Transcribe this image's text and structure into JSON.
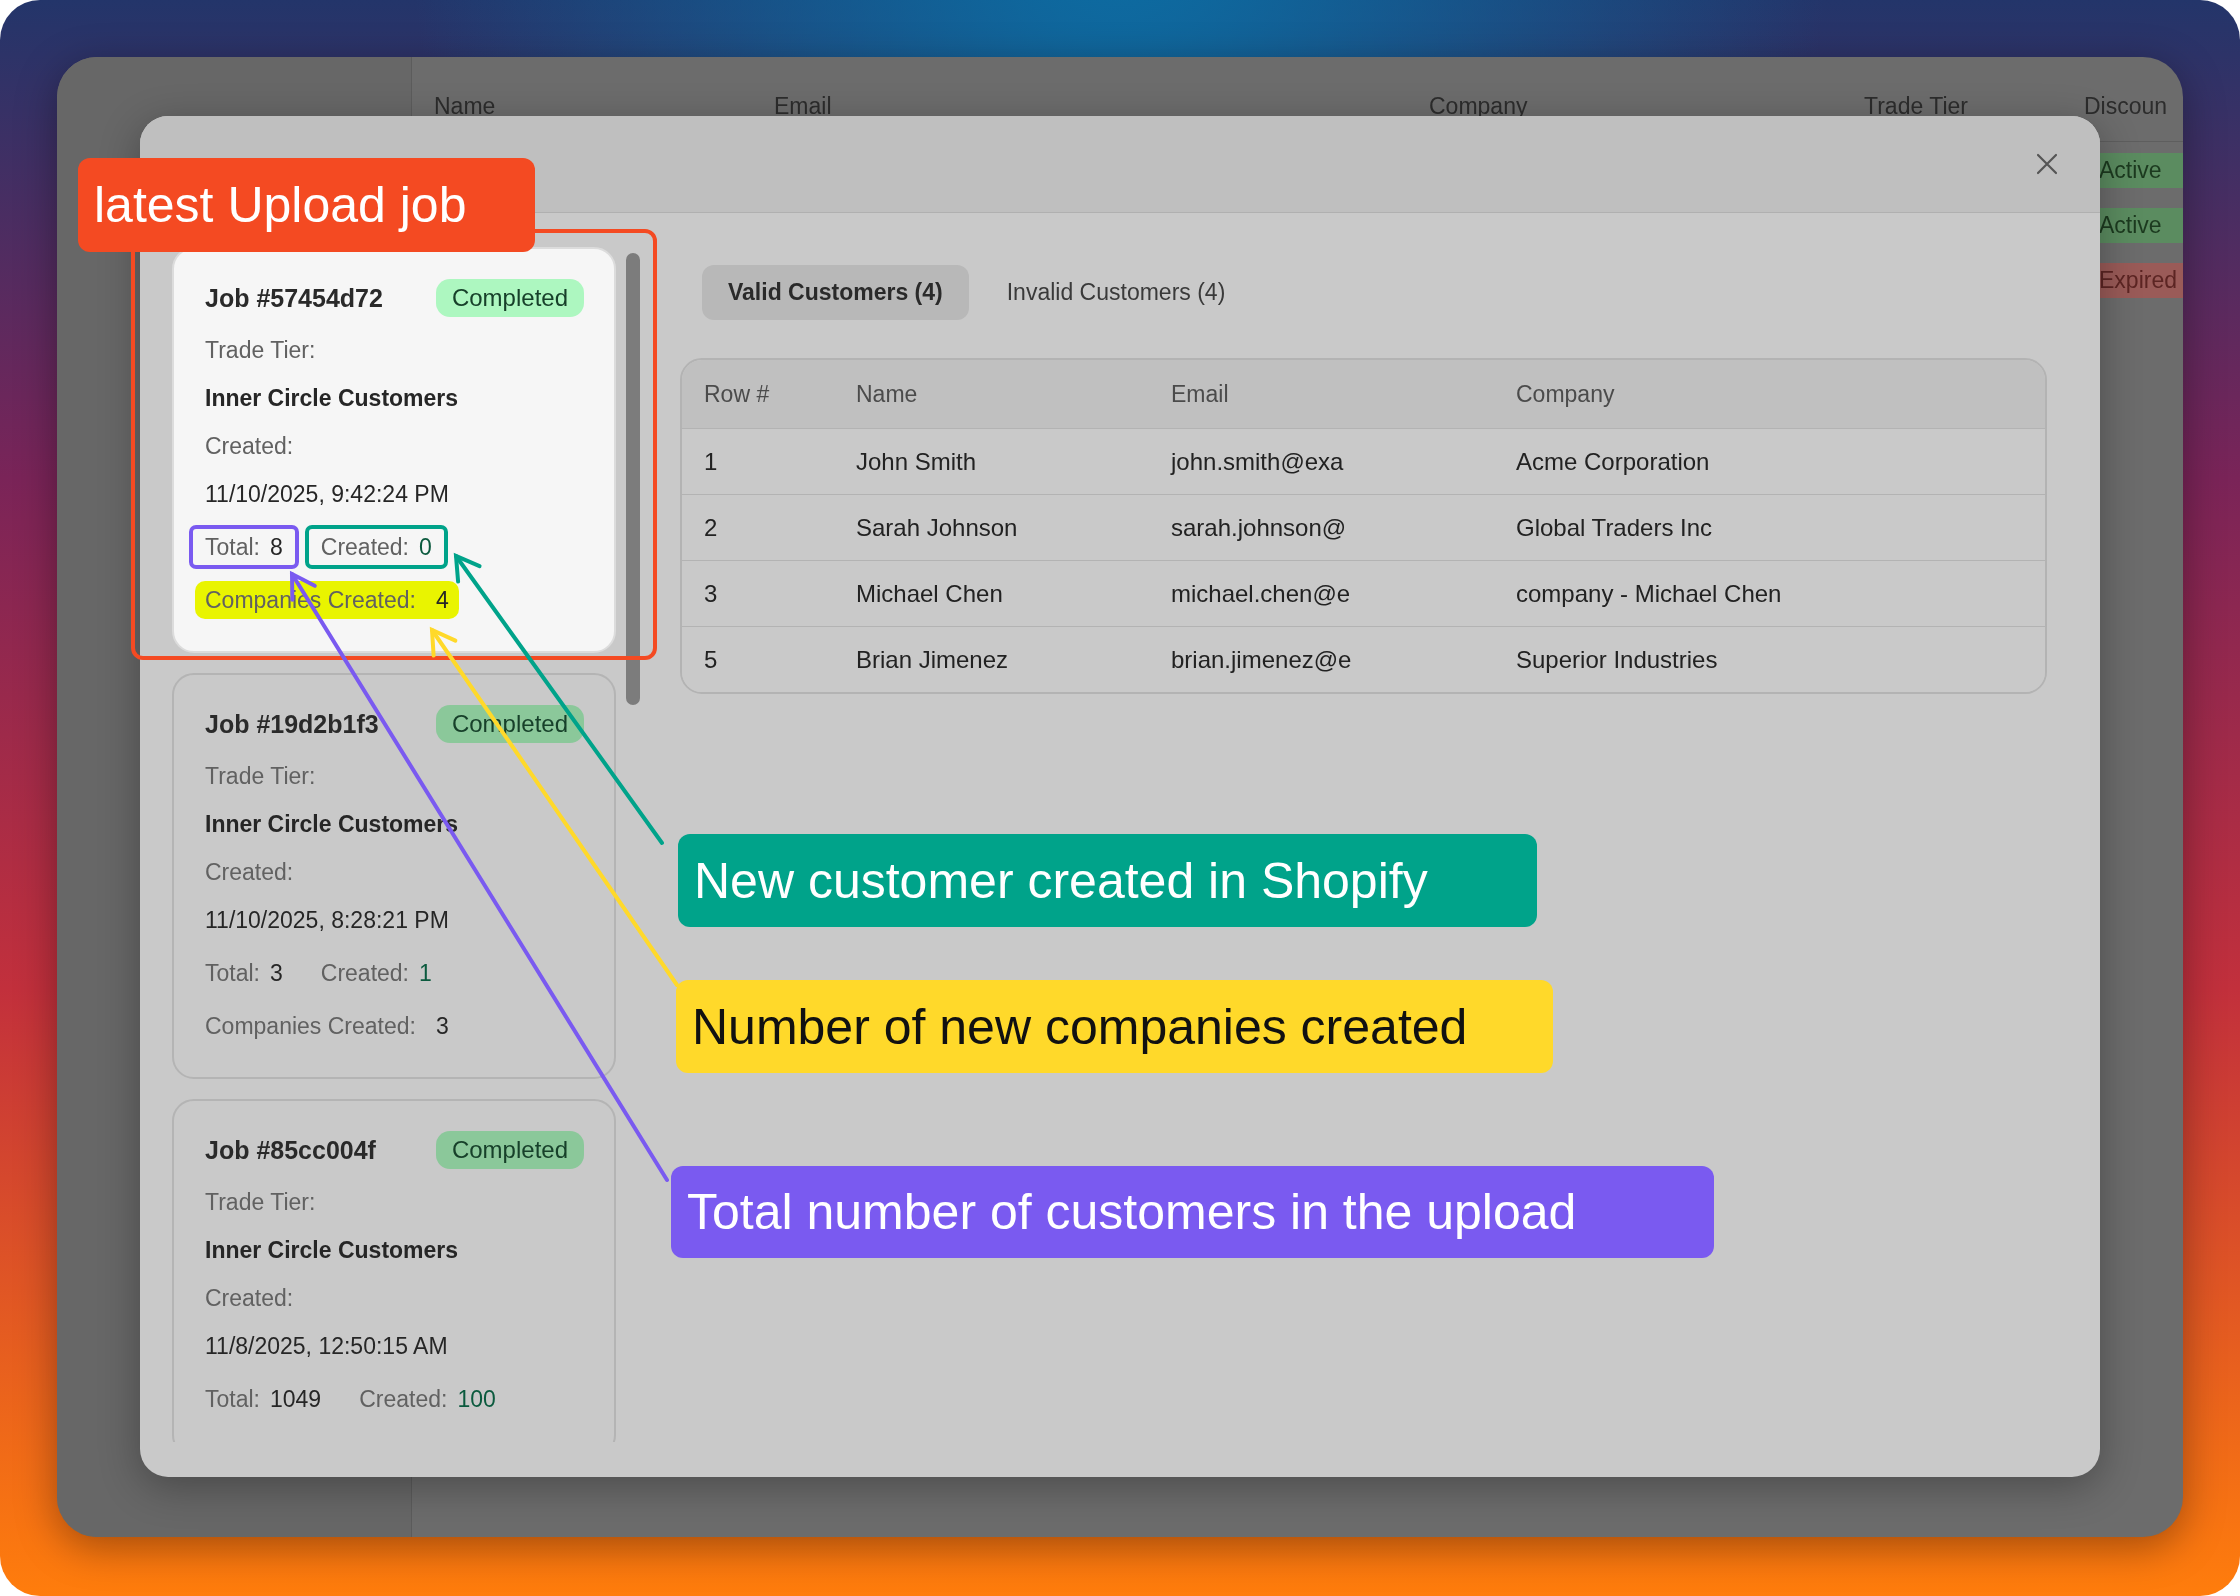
{
  "background_table": {
    "columns": [
      "Name",
      "Email",
      "Company",
      "Trade Tier",
      "Discoun"
    ],
    "statuses": [
      {
        "label": "Active",
        "kind": "active"
      },
      {
        "label": "Active",
        "kind": "active"
      },
      {
        "label": "Expired",
        "kind": "expired"
      }
    ]
  },
  "dialog": {
    "jobs": [
      {
        "title": "Job #57454d72",
        "status": "Completed",
        "highlighted": true,
        "trade_tier_label": "Trade Tier:",
        "trade_tier": "Inner Circle Customers",
        "created_label": "Created:",
        "created_at": "11/10/2025, 9:42:24 PM",
        "total_label": "Total:",
        "total": "8",
        "total_framed": true,
        "created_count_label": "Created:",
        "created_count": "0",
        "created_framed": true,
        "companies_label": "Companies Created:",
        "companies": "4",
        "companies_highlighted": true
      },
      {
        "title": "Job #19d2b1f3",
        "status": "Completed",
        "highlighted": false,
        "trade_tier_label": "Trade Tier:",
        "trade_tier": "Inner Circle Customers",
        "created_label": "Created:",
        "created_at": "11/10/2025, 8:28:21 PM",
        "total_label": "Total:",
        "total": "3",
        "total_framed": false,
        "created_count_label": "Created:",
        "created_count": "1",
        "created_framed": false,
        "companies_label": "Companies Created:",
        "companies": "3",
        "companies_highlighted": false
      },
      {
        "title": "Job #85cc004f",
        "status": "Completed",
        "highlighted": false,
        "trade_tier_label": "Trade Tier:",
        "trade_tier": "Inner Circle Customers",
        "created_label": "Created:",
        "created_at": "11/8/2025, 12:50:15 AM",
        "total_label": "Total:",
        "total": "1049",
        "total_framed": false,
        "created_count_label": "Created:",
        "created_count": "100",
        "created_framed": false
      }
    ],
    "tabs": [
      {
        "label": "Valid Customers (4)",
        "selected": true
      },
      {
        "label": "Invalid Customers (4)",
        "selected": false
      }
    ],
    "table": {
      "columns": [
        "Row #",
        "Name",
        "Email",
        "Company"
      ],
      "rows": [
        [
          "1",
          "John Smith",
          "john.smith@exa",
          "Acme Corporation"
        ],
        [
          "2",
          "Sarah Johnson",
          "sarah.johnson@",
          "Global Traders Inc"
        ],
        [
          "3",
          "Michael Chen",
          "michael.chen@e",
          "company - Michael Chen"
        ],
        [
          "5",
          "Brian Jimenez",
          "brian.jimenez@e",
          "Superior Industries"
        ]
      ]
    }
  },
  "annotations": [
    {
      "text": "latest Upload job",
      "color": "#f44a22"
    },
    {
      "text": "New customer created in Shopify",
      "color": "#00a38a"
    },
    {
      "text": "Number of new companies created",
      "color": "#ffd92a"
    },
    {
      "text": "Total number of customers in the upload",
      "color": "#7a5af0"
    }
  ]
}
